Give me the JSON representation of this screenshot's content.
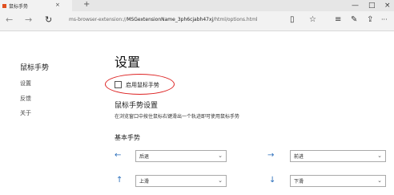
{
  "tab": {
    "title": "鼠标手势",
    "close": "×",
    "new_tab": "+"
  },
  "window": {
    "minimize": "—",
    "maximize": "□",
    "close": "×"
  },
  "nav": {
    "back": "←",
    "forward": "→",
    "refresh": "↻"
  },
  "address": {
    "prefix": "ms-browser-extension://",
    "bold": "MSGextensionName_3ph6cjabh47xj",
    "suffix": "/html/options.html"
  },
  "toolbar": {
    "reading_view": "▯",
    "favorite": "☆",
    "hub": "≡",
    "notes": "✎",
    "share": "⇪",
    "more": "···"
  },
  "sidebar": {
    "title": "鼠标手势",
    "items": [
      {
        "label": "设置"
      },
      {
        "label": "反馈"
      },
      {
        "label": "关于"
      }
    ]
  },
  "main": {
    "title": "设置",
    "enable_label": "启用鼠标手势",
    "enable_checked": false,
    "section_title": "鼠标手势设置",
    "section_desc": "在浏览窗口中按住鼠标右键滑出一个轨迹即可使用鼠标手势",
    "basic_title": "基本手势",
    "gestures": [
      {
        "arrow": "←",
        "value": "后退"
      },
      {
        "arrow": "→",
        "value": "前进"
      },
      {
        "arrow": "↑",
        "value": "上滑"
      },
      {
        "arrow": "↓",
        "value": "下滑"
      }
    ]
  },
  "colors": {
    "annotation": "#dd2222",
    "arrow": "#2a6ebb",
    "favicon": "#e05020"
  },
  "icons": [
    "tab-favicon-icon",
    "back-arrow-icon",
    "forward-arrow-icon",
    "refresh-icon",
    "reading-view-icon",
    "favorite-star-icon",
    "hub-icon",
    "web-note-icon",
    "share-icon",
    "more-icon",
    "chevron-down-icon"
  ]
}
